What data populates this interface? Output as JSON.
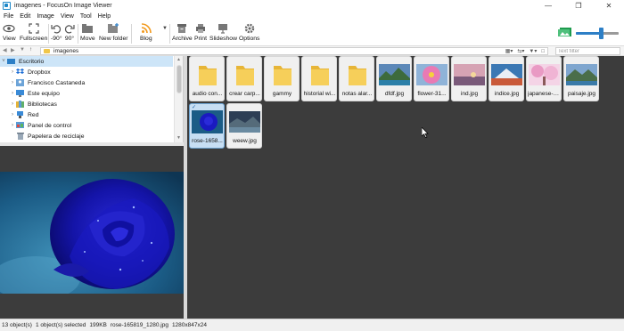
{
  "window": {
    "title": "imagenes - FocusOn Image Viewer"
  },
  "menu": [
    "File",
    "Edit",
    "Image",
    "View",
    "Tool",
    "Help"
  ],
  "toolbar": {
    "view": "View",
    "fullscreen": "Fullscreen",
    "rotate_left": "-90°",
    "rotate_right": "90°",
    "move": "Move",
    "new_folder": "New folder",
    "blog": "Blog",
    "archive": "Archive",
    "print": "Print",
    "slideshow": "Slideshow",
    "options": "Options",
    "zoom_level": 0.58
  },
  "address": {
    "path": "imagenes"
  },
  "filter": {
    "placeholder": "Text filter"
  },
  "tree": [
    {
      "label": "Escritorio",
      "icon": "desktop-icon"
    },
    {
      "label": "Dropbox",
      "icon": "dropbox-icon"
    },
    {
      "label": "Francisco Castaneda",
      "icon": "user-icon"
    },
    {
      "label": "Este equipo",
      "icon": "computer-icon"
    },
    {
      "label": "Bibliotecas",
      "icon": "library-icon"
    },
    {
      "label": "Red",
      "icon": "network-icon"
    },
    {
      "label": "Panel de control",
      "icon": "control-panel-icon"
    },
    {
      "label": "Papelera de reciclaje",
      "icon": "recycle-bin-icon"
    }
  ],
  "thumbnails": [
    {
      "caption": "audio con...",
      "kind": "folder"
    },
    {
      "caption": "crear carp...",
      "kind": "folder"
    },
    {
      "caption": "gammy",
      "kind": "folder"
    },
    {
      "caption": "historial wi...",
      "kind": "folder"
    },
    {
      "caption": "notas alar...",
      "kind": "folder"
    },
    {
      "caption": "dfdf.jpg",
      "kind": "image"
    },
    {
      "caption": "flower-31...",
      "kind": "image"
    },
    {
      "caption": "ind.jpg",
      "kind": "image"
    },
    {
      "caption": "indice.jpg",
      "kind": "image"
    },
    {
      "caption": "japanese-c...",
      "kind": "image"
    },
    {
      "caption": "paisaje.jpg",
      "kind": "image"
    },
    {
      "caption": "rose-1658...",
      "kind": "image",
      "selected": true
    },
    {
      "caption": "weew.jpg",
      "kind": "image"
    }
  ],
  "status": {
    "objects": "13 object(s)",
    "selected": "1 object(s) selected",
    "size": "199KB",
    "file": "rose-165819_1280.jpg",
    "dimensions": "1280x847x24"
  },
  "colors": {
    "accent": "#2d7fc6",
    "folder": "#f3c94b",
    "selection": "#c7def3",
    "panel_bg": "#3c3c3c"
  }
}
